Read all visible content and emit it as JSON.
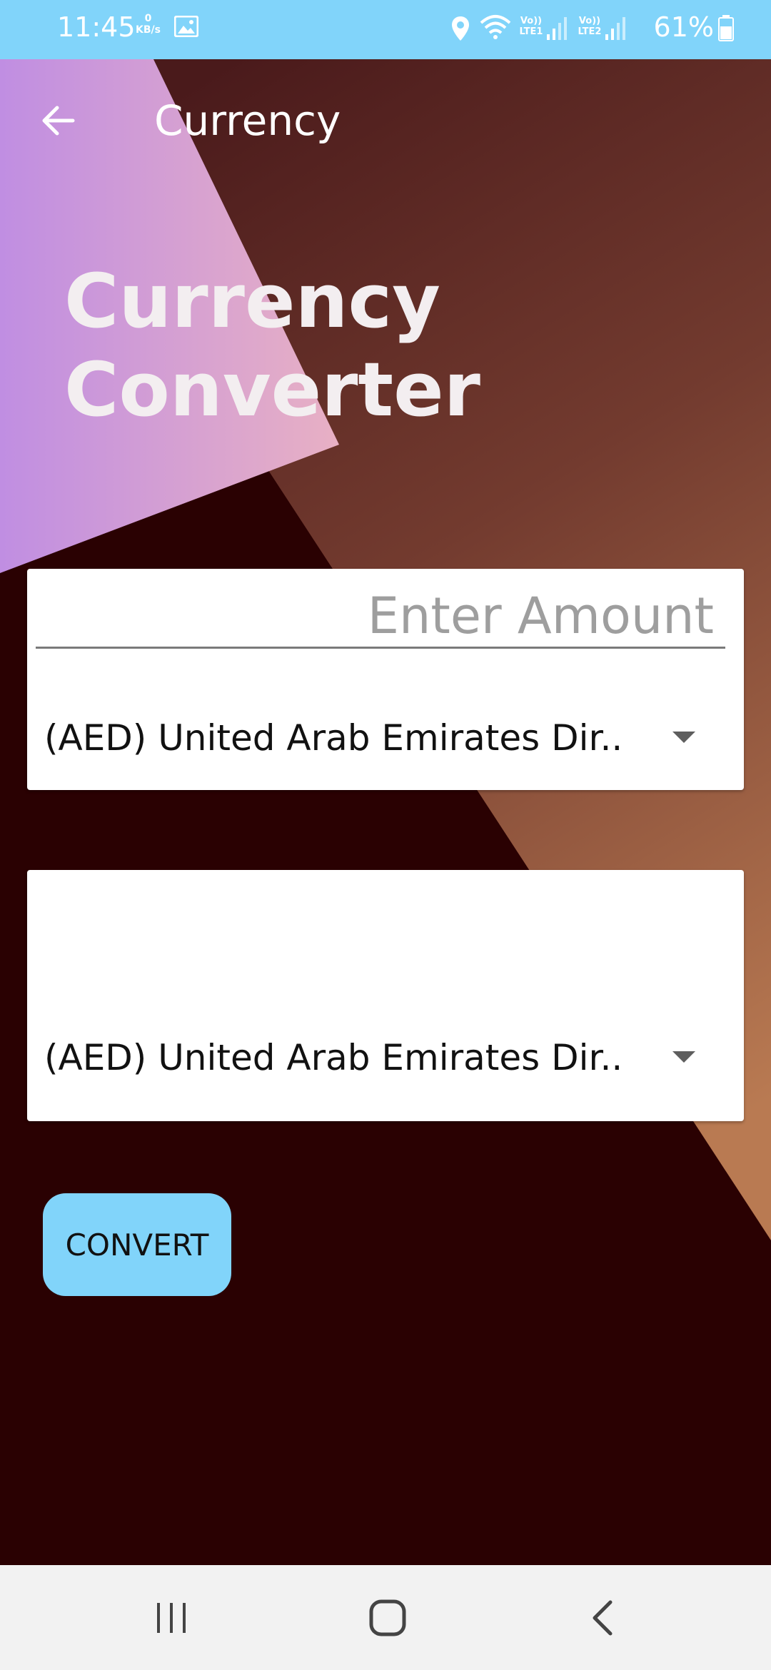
{
  "status_bar": {
    "time": "11:45",
    "net_speed_value": "0",
    "net_speed_unit": "KB/s",
    "sim1_label": "Vo)) LTE1",
    "sim2_label": "Vo)) LTE2",
    "battery": "61%"
  },
  "app_bar": {
    "title": "Currency"
  },
  "hero": {
    "line1": "Currency",
    "line2": "Converter"
  },
  "from_card": {
    "amount_placeholder": "Enter Amount",
    "amount_value": "",
    "currency_selected": "(AED) United Arab Emirates Dir.."
  },
  "to_card": {
    "result_value": "",
    "currency_selected": "(AED) United Arab Emirates Dir.."
  },
  "actions": {
    "convert_label": "CONVERT"
  },
  "colors": {
    "status_bar": "#81d4fa",
    "accent_button": "#81d4fa",
    "background_dark": "#2a0102",
    "gradient_brown_top": "#4b1d1c",
    "gradient_brown_bottom": "#b07250",
    "gradient_purple": "#c08fe0",
    "gradient_pink": "#e0a8c8"
  },
  "icons": {
    "back": "arrow-left-icon",
    "dropdown": "triangle-down-icon",
    "nav_recents": "recents-icon",
    "nav_home": "home-icon",
    "nav_back": "chevron-left-icon"
  }
}
